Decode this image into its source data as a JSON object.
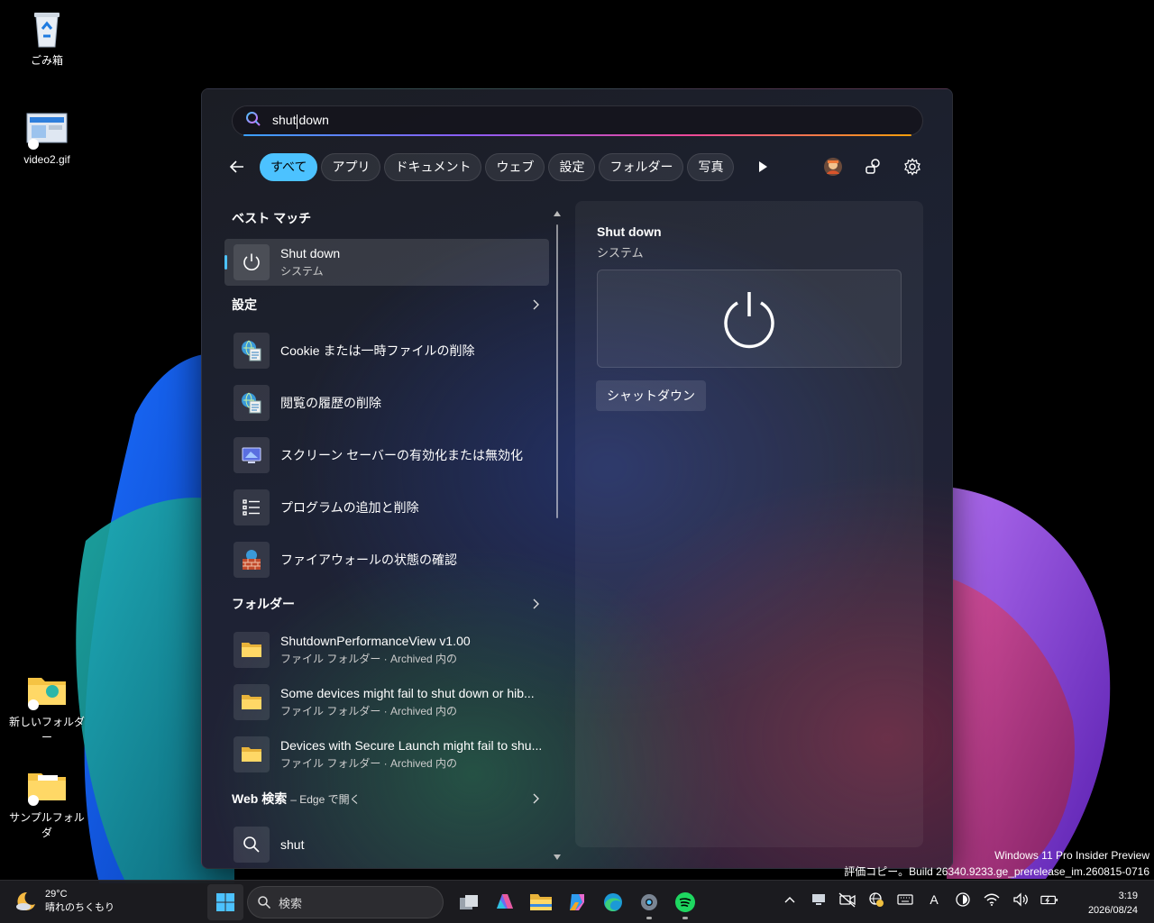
{
  "desktop": {
    "icons": [
      {
        "label": "ごみ箱"
      },
      {
        "label": "video2.gif"
      },
      {
        "label": "新しいフォルダー"
      },
      {
        "label": "サンプルフォルダ"
      }
    ]
  },
  "search": {
    "query_before_caret": "shut",
    "query_after_caret": "down"
  },
  "filters": [
    "すべて",
    "アプリ",
    "ドキュメント",
    "ウェブ",
    "設定",
    "フォルダー",
    "写真"
  ],
  "results": {
    "best_match": {
      "heading": "ベスト マッチ",
      "item": {
        "title": "Shut down",
        "subtitle": "システム",
        "icon": "power-icon"
      }
    },
    "settings": {
      "heading": "設定",
      "items": [
        {
          "title": "Cookie または一時ファイルの削除",
          "icon": "internet-options-icon"
        },
        {
          "title": "閲覧の履歴の削除",
          "icon": "internet-options-icon"
        },
        {
          "title": "スクリーン セーバーの有効化または無効化",
          "icon": "screensaver-icon"
        },
        {
          "title": "プログラムの追加と削除",
          "icon": "list-icon"
        },
        {
          "title": "ファイアウォールの状態の確認",
          "icon": "firewall-icon"
        }
      ]
    },
    "folders": {
      "heading": "フォルダー",
      "items": [
        {
          "title": "ShutdownPerformanceView v1.00",
          "subtitle": "ファイル フォルダー · Archived 内の"
        },
        {
          "title": "Some devices might fail to shut down or hib...",
          "subtitle": "ファイル フォルダー · Archived 内の"
        },
        {
          "title": "Devices with Secure Launch might fail to shu...",
          "subtitle": "ファイル フォルダー · Archived 内の"
        }
      ]
    },
    "web": {
      "heading": "Web 検索",
      "heading_sub": "– Edge で開く",
      "item": {
        "title": "shut"
      }
    }
  },
  "preview": {
    "title": "Shut down",
    "subtitle": "システム",
    "action_label": "シャットダウン"
  },
  "watermark": {
    "line1": "Windows 11 Pro Insider Preview",
    "line2": "評価コピー。Build 26340.9233.ge_prerelease_im.260815-0716"
  },
  "taskbar": {
    "weather_temp": "29°C",
    "weather_desc": "晴れのちくもり",
    "search_placeholder": "検索",
    "tray_ime": "A",
    "time": "3:19",
    "date": "2026/08/24"
  },
  "colors": {
    "accent": "#4cc2ff",
    "taskbar_bg": "#1c1c20"
  }
}
